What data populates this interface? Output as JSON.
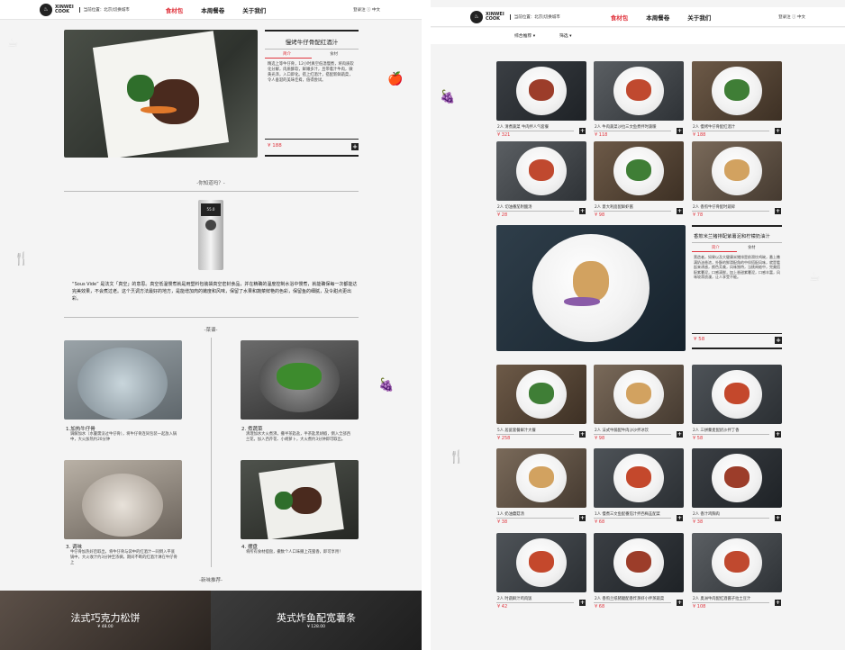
{
  "brand": {
    "name_line1": "XINWEI",
    "name_line2": "COOK"
  },
  "left": {
    "header": {
      "location": "当前位置：北京|切换城市",
      "nav": [
        "食材包",
        "本周餐卷",
        "关于我们"
      ],
      "right": "登录注 ⓘ 中文"
    },
    "product": {
      "title": "慢烤牛仔骨配红酒汁",
      "tabs": [
        "简介",
        "食材"
      ],
      "desc": "精选上等牛仔骨，12小时真空低温慢煮，将肉质软化分解，肉质酥软，鲜嫩多汁，且带着汁牛肉，微黄光泽，入口即化。搭上红酒汁，搭配新鲜蔬菜，令人垂涎的美味佳肴，值得尝试。",
      "price": "¥ 188"
    },
    "know_title": "-你知道吗？-",
    "device_screen": "55.0",
    "sous_vide": "“Sous Vide” 是法文「真空」的意思。真空低温慢煮就是用塑料包装袋真空密封食品，并在精确的温度控制水浴中慢煮，就能确保每一次都能达完美效果，不会煮过老。这个烹调方法最好的地方，是能增加肉的嫩度和风味，保留了水果和蔬菜鲜艳的色彩，保留鱼的细腻，及令甜点更出彩。",
    "steps_title": "-菜谱-",
    "steps": [
      {
        "num": "1",
        "title": "加热牛仔骨",
        "desc": "调解加水（水量需没过牛仔骨），将牛仔骨连同包装一起放入锅中，大火加热约20分钟"
      },
      {
        "num": "2",
        "title": "煮蔬菜",
        "desc": "清理加水大火煮沸，撒半茶匙盐，半茶匙黑胡椒，倒入全部西兰花，加入西芹花、小胡萝卜，大火煮约3分钟即可取出。"
      },
      {
        "num": "3",
        "title": "调味",
        "desc": "牛仔骨加热好后取出，将牛仔骨与袋中的红酒汁一同倒入平底锅中，大火收汁约3分钟至浓稠，期间不断的红酒汁淋在牛仔骨上"
      },
      {
        "num": "4",
        "title": "摆盘",
        "desc": "将所有食材摆盘，撒数个人口味撒上花蜜香，即可享用！"
      }
    ],
    "rec_title": "-新味推荐-",
    "banners": [
      {
        "title": "法式巧克力松饼",
        "price": "¥ 48.00"
      },
      {
        "title": "英式炸鱼配宽薯条",
        "price": "¥ 128.00"
      }
    ]
  },
  "right": {
    "header": {
      "location": "当前位置：北京|切换城市",
      "nav": [
        "食材包",
        "本周餐卷",
        "关于我们"
      ],
      "right": "登录注 ⓘ 中文"
    },
    "filters": [
      "综合推荐",
      "筛选"
    ],
    "grid_row1": [
      {
        "caption": "2人  清煮蔬菜 牛肉拌人气套餐",
        "price": "¥ 321"
      },
      {
        "caption": "2人  牛肉蔬菜沙拉三文鱼煮拌时蔬暖",
        "price": "¥ 118"
      },
      {
        "caption": "2人  慢烤牛仔骨配红酒汁",
        "price": "¥ 188"
      }
    ],
    "grid_row2": [
      {
        "caption": "2人  切油番茄附酸汤",
        "price": "¥ 28"
      },
      {
        "caption": "2人  意大利面配鲜虾酱",
        "price": "¥ 98"
      },
      {
        "caption": "2人  香煎牛仔骨配时蔬碎",
        "price": "¥ 78"
      }
    ],
    "featured": {
      "title": "香煎米兰猪排配紫薯泥和柠檬奶油汁",
      "tabs": [
        "简介",
        "食材"
      ],
      "desc": "营造者，如果以及大健康米猪排是前滑饮鸡碗，番上撒满奶油香浓，外酥的鲜滑配角的中伴搭配风味，就是看起来诱惑，颜色芳美，风味独特，当挑肉蛤中，完美搭配紫薯泥，口感清鲜，加上香甜紫薯泥，口感丰富，风味较滑浪漫，让人享受不能。",
      "price": "¥ 58"
    },
    "grid_row3": [
      {
        "caption": "5人  居庭套餐鲜汁大餐",
        "price": "¥ 258"
      },
      {
        "caption": "2人  法式牛腩配牛肉沙沙拌冰饮",
        "price": "¥ 98"
      },
      {
        "caption": "2人  三拼藜麦配奶沙拌丁香",
        "price": "¥ 58"
      }
    ],
    "grid_row4": [
      {
        "caption": "1人  奶油蘑菇汤",
        "price": "¥ 38"
      },
      {
        "caption": "1人  慢煮三文鱼配番茄汁拌西梅韭配菜",
        "price": "¥ 68"
      },
      {
        "caption": "2人  香汁鸡胸肉",
        "price": "¥ 38"
      }
    ],
    "grid_row5": [
      {
        "caption": "2人  时蔬鲜汁鸡肉饭",
        "price": "¥ 42"
      },
      {
        "caption": "2人  香煎兰纸猪腿配香炸蒸虾小拌蒸蔬菜",
        "price": "¥ 68"
      },
      {
        "caption": "2人  奥洲牛肉配红酒酱子拉土豆汁",
        "price": "¥ 108"
      }
    ]
  },
  "colors": {
    "accent": "#e0363f",
    "dark": "#222222"
  }
}
